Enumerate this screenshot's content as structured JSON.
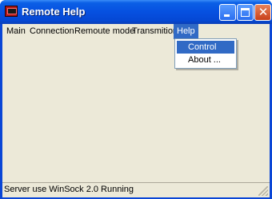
{
  "window": {
    "title": "Remote Help"
  },
  "menu": {
    "items": [
      "Main",
      "Connection",
      "Remoute mode",
      "Transmition",
      "Help"
    ],
    "open": "Help"
  },
  "help_menu": {
    "items": [
      "Control",
      "About ..."
    ],
    "highlighted": "Control"
  },
  "status": {
    "text": "Server use WinSock 2.0 Running"
  },
  "colors": {
    "title_bar": "#0554e3",
    "selection": "#316ac5",
    "face": "#ece9d8"
  }
}
